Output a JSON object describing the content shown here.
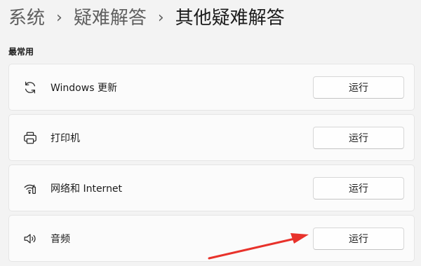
{
  "breadcrumb": {
    "items": [
      "系统",
      "疑难解答"
    ],
    "separator": "›",
    "current": "其他疑难解答"
  },
  "section": {
    "title": "最常用"
  },
  "troubleshooters": [
    {
      "label": "Windows 更新",
      "icon": "refresh-icon",
      "button": "运行"
    },
    {
      "label": "打印机",
      "icon": "printer-icon",
      "button": "运行"
    },
    {
      "label": "网络和 Internet",
      "icon": "network-icon",
      "button": "运行"
    },
    {
      "label": "音频",
      "icon": "speaker-icon",
      "button": "运行"
    }
  ],
  "annotation": {
    "arrow_color": "#e8322b"
  },
  "colors": {
    "background": "#f3f3f3",
    "card": "#fbfbfb",
    "text": "#1b1b1b",
    "muted": "#5f5f5f"
  }
}
